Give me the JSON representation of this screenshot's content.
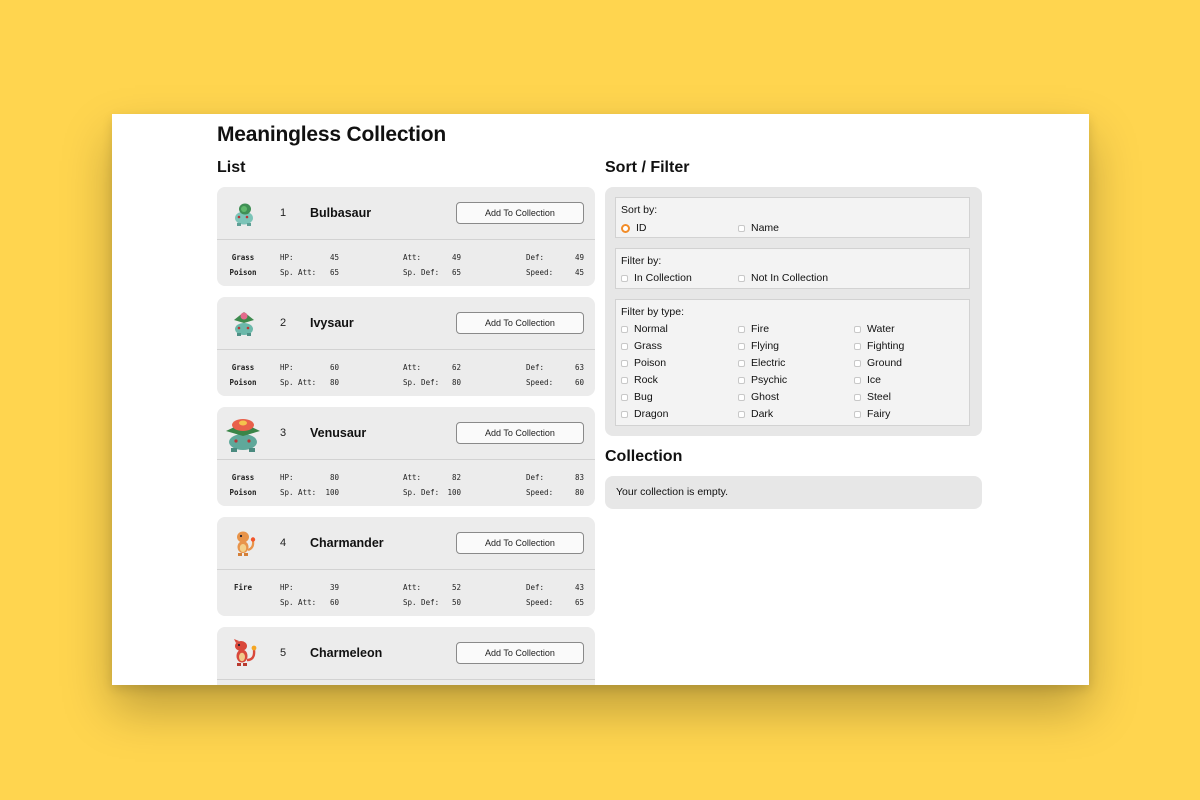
{
  "page": {
    "title": "Meaningless Collection"
  },
  "list": {
    "title": "List",
    "add_label": "Add To Collection",
    "stat_labels": {
      "hp": "HP:",
      "att": "Att:",
      "def": "Def:",
      "sp_att": "Sp. Att:",
      "sp_def": "Sp. Def:",
      "speed": "Speed:"
    },
    "items": [
      {
        "id": "1",
        "name": "Bulbasaur",
        "types": [
          "Grass",
          "Poison"
        ],
        "hp": "45",
        "att": "49",
        "def": "49",
        "sp_att": "65",
        "sp_def": "65",
        "speed": "45",
        "sprite": "bulbasaur-sprite-icon"
      },
      {
        "id": "2",
        "name": "Ivysaur",
        "types": [
          "Grass",
          "Poison"
        ],
        "hp": "60",
        "att": "62",
        "def": "63",
        "sp_att": "80",
        "sp_def": "80",
        "speed": "60",
        "sprite": "ivysaur-sprite-icon"
      },
      {
        "id": "3",
        "name": "Venusaur",
        "types": [
          "Grass",
          "Poison"
        ],
        "hp": "80",
        "att": "82",
        "def": "83",
        "sp_att": "100",
        "sp_def": "100",
        "speed": "80",
        "sprite": "venusaur-sprite-icon"
      },
      {
        "id": "4",
        "name": "Charmander",
        "types": [
          "Fire"
        ],
        "hp": "39",
        "att": "52",
        "def": "43",
        "sp_att": "60",
        "sp_def": "50",
        "speed": "65",
        "sprite": "charmander-sprite-icon"
      },
      {
        "id": "5",
        "name": "Charmeleon",
        "sprite": "charmeleon-sprite-icon"
      }
    ]
  },
  "sort_filter": {
    "title": "Sort / Filter",
    "sort_by": {
      "label": "Sort by:",
      "options": [
        "ID",
        "Name"
      ],
      "selected": "ID"
    },
    "filter_by": {
      "label": "Filter by:",
      "options": [
        "In Collection",
        "Not In Collection"
      ]
    },
    "filter_by_type": {
      "label": "Filter by type:",
      "options": [
        "Normal",
        "Fire",
        "Water",
        "Grass",
        "Flying",
        "Fighting",
        "Poison",
        "Electric",
        "Ground",
        "Rock",
        "Psychic",
        "Ice",
        "Bug",
        "Ghost",
        "Steel",
        "Dragon",
        "Dark",
        "Fairy"
      ]
    }
  },
  "collection": {
    "title": "Collection",
    "empty_text": "Your collection is empty."
  },
  "colors": {
    "background": "#FFD54F",
    "card": "#ECECEC",
    "panel": "#E7E7E7",
    "radio_accent": "#F28C28"
  }
}
